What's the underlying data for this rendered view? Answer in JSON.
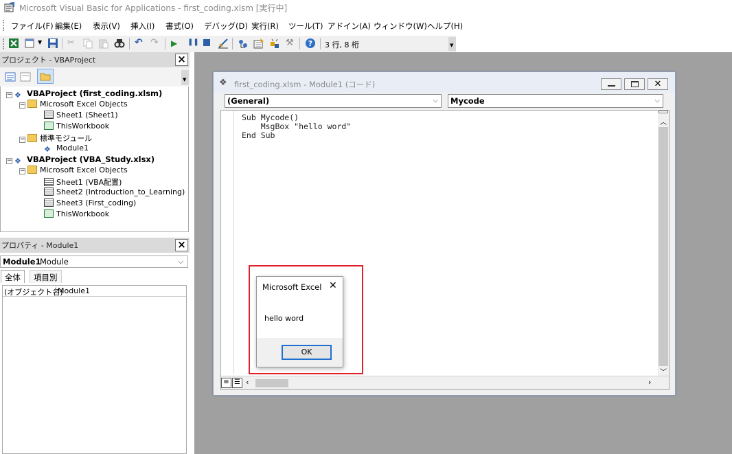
{
  "window": {
    "title": "Microsoft Visual Basic for Applications - first_coding.xlsm [実行中]"
  },
  "menu": [
    {
      "label": "ファイル(F)"
    },
    {
      "label": "編集(E)"
    },
    {
      "label": "表示(V)"
    },
    {
      "label": "挿入(I)"
    },
    {
      "label": "書式(O)"
    },
    {
      "label": "デバッグ(D)"
    },
    {
      "label": "実行(R)"
    },
    {
      "label": "ツール(T)"
    },
    {
      "label": "アドイン(A)"
    },
    {
      "label": "ウィンドウ(W)"
    },
    {
      "label": "ヘルプ(H)"
    }
  ],
  "toolbar": {
    "position": "3 行, 8 桁"
  },
  "project": {
    "title": "プロジェクト - VBAProject",
    "tree": {
      "p1": "VBAProject (first_coding.xlsm)",
      "p1_objects": "Microsoft Excel Objects",
      "p1_sheet1": "Sheet1 (Sheet1)",
      "p1_thisworkbook": "ThisWorkbook",
      "p1_modules": "標準モジュール",
      "p1_module1": "Module1",
      "p2": "VBAProject (VBA_Study.xlsx)",
      "p2_objects": "Microsoft Excel Objects",
      "p2_sheet1": "Sheet1 (VBA配置)",
      "p2_sheet2": "Sheet2 (Introduction_to_Learning)",
      "p2_sheet3": "Sheet3 (First_coding)",
      "p2_thisworkbook": "ThisWorkbook"
    }
  },
  "properties": {
    "title": "プロパティ - Module1",
    "object_name": "Module1",
    "object_type": "Module",
    "tabs": [
      "全体",
      "項目別"
    ],
    "row_name": "(オブジェクト名)",
    "row_value": "Module1"
  },
  "code_window": {
    "title": "first_coding.xlsm - Module1 (コード)",
    "object_combo": "(General)",
    "proc_combo": "Mycode",
    "lines": [
      "Sub Mycode()",
      "    MsgBox \"hello word\"",
      "End Sub"
    ]
  },
  "msgbox": {
    "title": "Microsoft Excel",
    "message": "hello word",
    "ok": "OK"
  },
  "colors": {
    "highlight_box": "#e0212b",
    "mdi_background": "#a0a0a0"
  }
}
